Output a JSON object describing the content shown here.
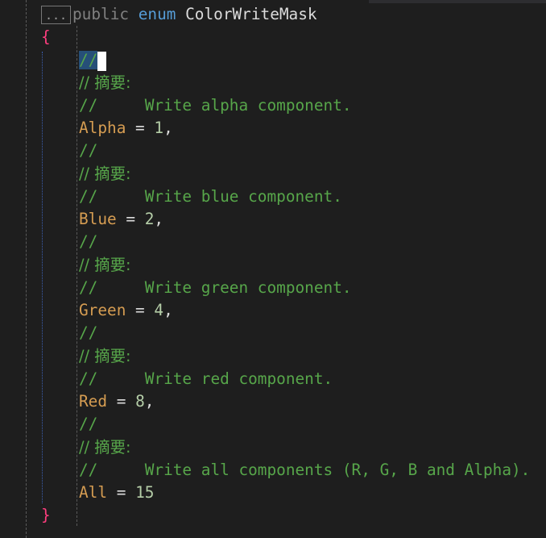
{
  "header": {
    "collapsed_marker": "...",
    "access": "public",
    "enum_kw": "enum",
    "type_name": "ColorWriteMask"
  },
  "braces": {
    "open": "{",
    "close": "}"
  },
  "first_comment": "//",
  "members": [
    {
      "summary_tag": "// 摘要:",
      "desc": "//     Write alpha component.",
      "name": "Alpha",
      "eq": " = ",
      "value": "1",
      "sep": ","
    },
    {
      "slash": "//",
      "summary_tag": "// 摘要:",
      "desc": "//     Write blue component.",
      "name": "Blue",
      "eq": " = ",
      "value": "2",
      "sep": ","
    },
    {
      "slash": "//",
      "summary_tag": "// 摘要:",
      "desc": "//     Write green component.",
      "name": "Green",
      "eq": " = ",
      "value": "4",
      "sep": ","
    },
    {
      "slash": "//",
      "summary_tag": "// 摘要:",
      "desc": "//     Write red component.",
      "name": "Red",
      "eq": " = ",
      "value": "8",
      "sep": ","
    },
    {
      "slash": "//",
      "summary_tag": "// 摘要:",
      "desc": "//     Write all components (R, G, B and Alpha).",
      "name": "All",
      "eq": " = ",
      "value": "15",
      "sep": ""
    }
  ],
  "colors": {
    "background": "#1e1e1e",
    "comment": "#57a64a",
    "keyword": "#569cd6",
    "enum_member": "#d69d52",
    "brace": "#ff3e7f",
    "number": "#b5cea8",
    "selection": "#264f78"
  }
}
